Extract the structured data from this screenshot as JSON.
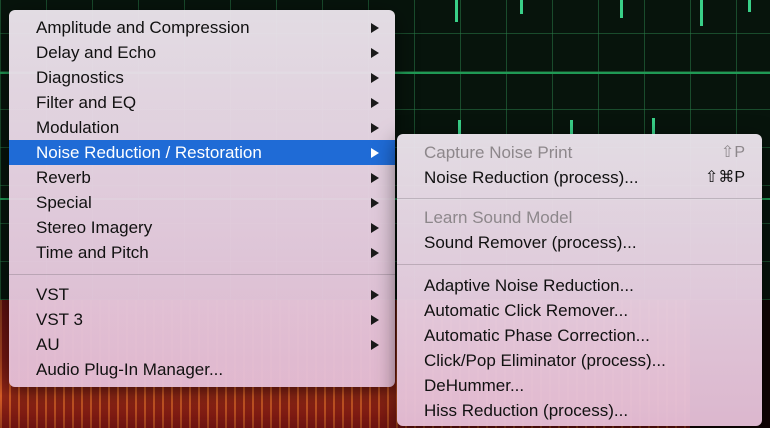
{
  "main_menu": {
    "group1": [
      {
        "label": "Amplitude and Compression",
        "submenu": true
      },
      {
        "label": "Delay and Echo",
        "submenu": true
      },
      {
        "label": "Diagnostics",
        "submenu": true
      },
      {
        "label": "Filter and EQ",
        "submenu": true
      },
      {
        "label": "Modulation",
        "submenu": true
      },
      {
        "label": "Noise Reduction / Restoration",
        "submenu": true,
        "selected": true
      },
      {
        "label": "Reverb",
        "submenu": true
      },
      {
        "label": "Special",
        "submenu": true
      },
      {
        "label": "Stereo Imagery",
        "submenu": true
      },
      {
        "label": "Time and Pitch",
        "submenu": true
      }
    ],
    "group2": [
      {
        "label": "VST",
        "submenu": true
      },
      {
        "label": "VST 3",
        "submenu": true
      },
      {
        "label": "AU",
        "submenu": true
      },
      {
        "label": "Audio Plug-In Manager...",
        "submenu": false
      }
    ]
  },
  "sub_menu": {
    "group1": [
      {
        "label": "Capture Noise Print",
        "shortcut": "⇧P",
        "disabled": true
      },
      {
        "label": "Noise Reduction (process)...",
        "shortcut": "⇧⌘P",
        "disabled": false
      }
    ],
    "group2": [
      {
        "label": "Learn Sound Model",
        "disabled": true
      },
      {
        "label": "Sound Remover (process)...",
        "disabled": false
      }
    ],
    "group3": [
      {
        "label": "Adaptive Noise Reduction..."
      },
      {
        "label": "Automatic Click Remover..."
      },
      {
        "label": "Automatic Phase Correction..."
      },
      {
        "label": "Click/Pop Eliminator (process)..."
      },
      {
        "label": "DeHummer..."
      },
      {
        "label": "Hiss Reduction (process)..."
      }
    ]
  },
  "colors": {
    "selection": "#1f6bd6",
    "waveform": "#39d088",
    "disabled_text": "#8d878b"
  }
}
